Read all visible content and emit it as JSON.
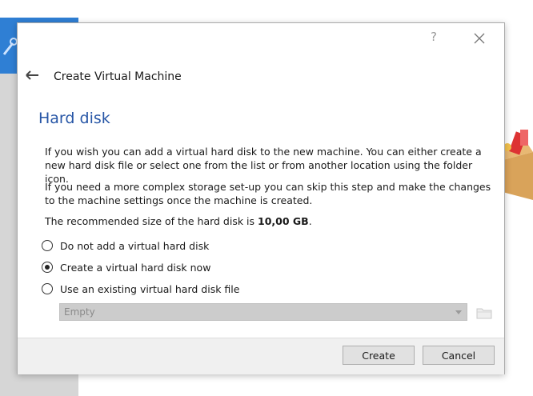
{
  "titlebar": {
    "help_symbol": "?"
  },
  "wizard": {
    "title": "Create Virtual Machine"
  },
  "page": {
    "title": "Hard disk",
    "paragraph1": "If you wish you can add a virtual hard disk to the new machine. You can either create a new hard disk file or select one from the list or from another location using the folder icon.",
    "paragraph2": "If you need a more complex storage set-up you can skip this step and make the changes to the machine settings once the machine is created.",
    "recommended_prefix": "The recommended size of the hard disk is ",
    "recommended_size": "10,00 GB",
    "recommended_suffix": "."
  },
  "options": [
    {
      "label": "Do not add a virtual hard disk",
      "checked": false
    },
    {
      "label": "Create a virtual hard disk now",
      "checked": true
    },
    {
      "label": "Use an existing virtual hard disk file",
      "checked": false
    }
  ],
  "existing_disk_select": {
    "value": "Empty",
    "enabled": false
  },
  "buttons": {
    "create": "Create",
    "cancel": "Cancel"
  },
  "colors": {
    "title_blue": "#2756a6",
    "footer_bg": "#f0f0f0",
    "sidebar_blue": "#2f7fd4"
  },
  "icons": [
    "close-icon",
    "back-arrow-icon",
    "folder-icon",
    "tool-icon",
    "toolbox-icon"
  ]
}
